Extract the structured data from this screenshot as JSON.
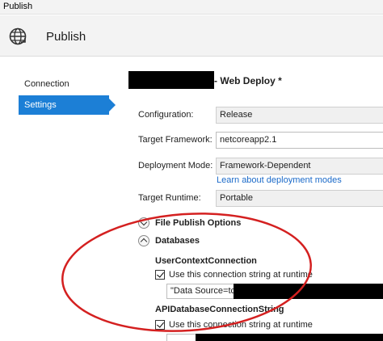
{
  "window": {
    "title": "Publish"
  },
  "header": {
    "title": "Publish",
    "icon": "globe-publish-icon"
  },
  "sidebar": {
    "items": [
      {
        "label": "Connection",
        "selected": false
      },
      {
        "label": "Settings",
        "selected": true
      }
    ],
    "accent_color": "#1c7fd6"
  },
  "profile": {
    "title_suffix": "- Web Deploy *"
  },
  "settings": {
    "configuration": {
      "label": "Configuration:",
      "value": "Release"
    },
    "target_framework": {
      "label": "Target Framework:",
      "value": "netcoreapp2.1"
    },
    "deployment_mode": {
      "label": "Deployment Mode:",
      "value": "Framework-Dependent",
      "link": "Learn about deployment modes"
    },
    "target_runtime": {
      "label": "Target Runtime:",
      "value": "Portable"
    }
  },
  "sections": {
    "file_publish_options": {
      "label": "File Publish Options",
      "expanded": false
    },
    "databases": {
      "label": "Databases",
      "expanded": true,
      "items": [
        {
          "name": "UserContextConnection",
          "checkbox_label": "Use this connection string at runtime",
          "checked": true,
          "value": "\"Data Source=tcp"
        },
        {
          "name": "APIDatabaseConnectionString",
          "checkbox_label": "Use this connection string at runtime",
          "checked": true,
          "value": ""
        }
      ]
    }
  },
  "annotation": {
    "color": "#d42020"
  }
}
